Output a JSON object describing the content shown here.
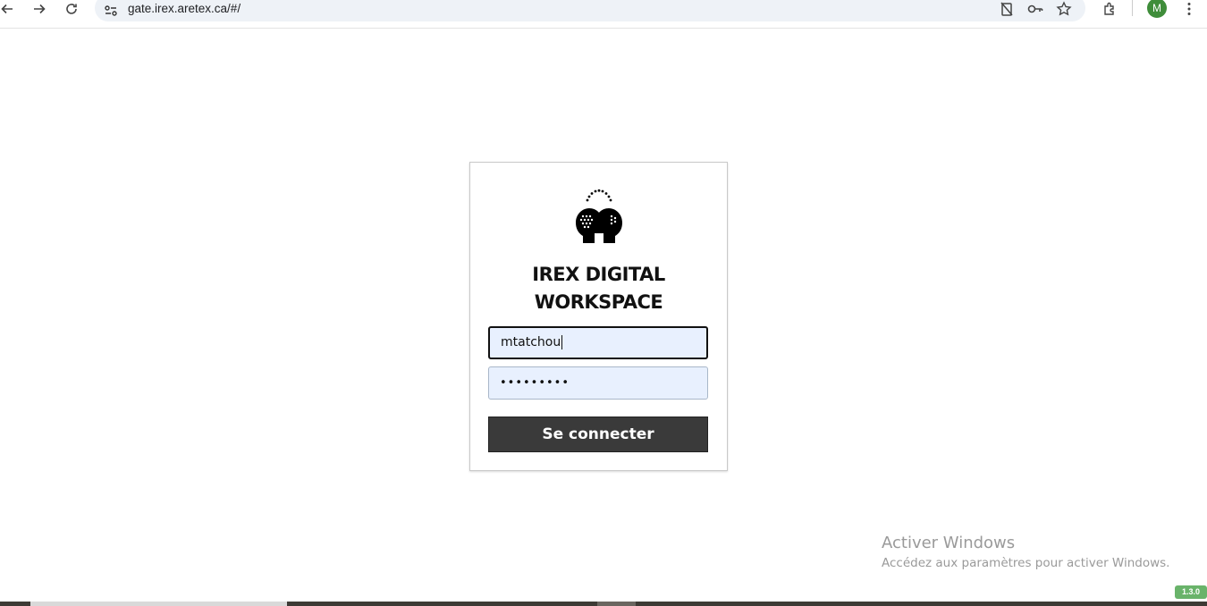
{
  "browser": {
    "url": "gate.irex.aretex.ca/#/",
    "profile_initial": "M",
    "icons": [
      "back-icon",
      "forward-icon",
      "reload-icon",
      "site-info-icon",
      "no-clipboard-icon",
      "key-icon",
      "star-icon",
      "extensions-icon",
      "more-icon"
    ]
  },
  "login": {
    "title_line1": "IREX DIGITAL",
    "title_line2": "WORKSPACE",
    "username_value": "mtatchou",
    "password_value": "•••••••••",
    "submit_label": "Se connecter",
    "logo_icon": "two-heads-icon"
  },
  "watermark": {
    "title": "Activer Windows",
    "subtitle": "Accédez aux paramètres pour activer Windows."
  },
  "version_badge": "1.3.0",
  "colors": {
    "button_bg": "#3a3a3a",
    "field_bg": "#e8f0fe",
    "badge_bg": "#69b36a",
    "avatar_bg": "#3f8d3a"
  }
}
